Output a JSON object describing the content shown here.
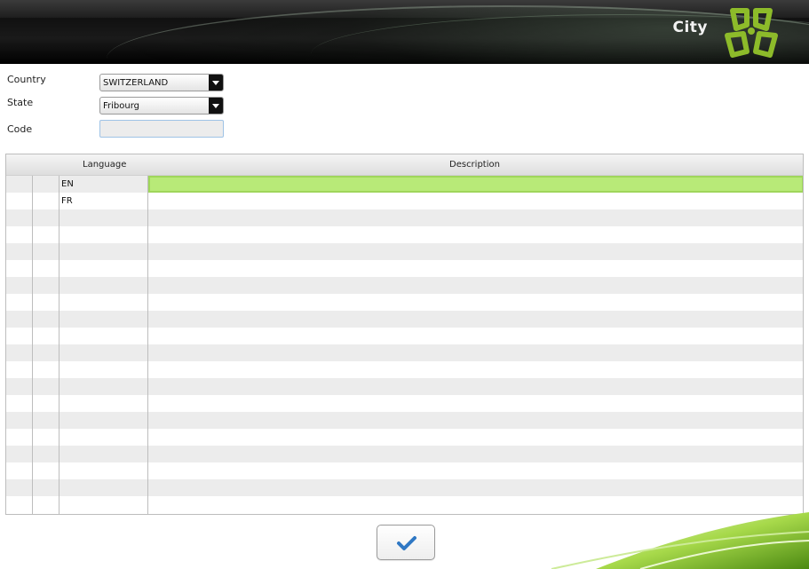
{
  "header": {
    "title": "City"
  },
  "form": {
    "country_label": "Country",
    "country_value": "SWITZERLAND",
    "state_label": "State",
    "state_value": "Fribourg",
    "code_label": "Code",
    "code_value": ""
  },
  "grid": {
    "columns": [
      "Language",
      "Description"
    ],
    "rows": [
      {
        "language": "EN",
        "description": ""
      },
      {
        "language": "FR",
        "description": ""
      }
    ],
    "selected_row": 0,
    "total_visible_rows": 20
  },
  "footer": {
    "ok_icon": "checkmark-icon"
  },
  "colors": {
    "accent_green": "#b8ea78",
    "logo_green": "#8dbb2a",
    "header_dark": "#111111"
  }
}
